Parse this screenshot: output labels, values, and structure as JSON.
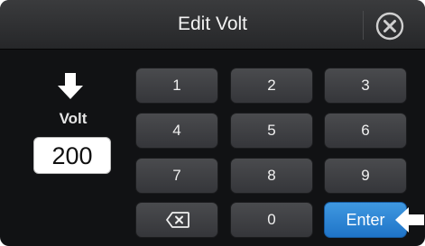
{
  "dialog": {
    "title": "Edit Volt",
    "close_icon": "close-circle-icon"
  },
  "field": {
    "label": "Volt",
    "value": "200",
    "indicator_icon": "arrow-down-icon"
  },
  "keypad": {
    "keys": [
      "1",
      "2",
      "3",
      "4",
      "5",
      "6",
      "7",
      "8",
      "9"
    ],
    "backspace_icon": "backspace-icon",
    "zero": "0",
    "enter": "Enter",
    "enter_indicator_icon": "arrow-left-icon"
  },
  "colors": {
    "background": "#111214",
    "key": "#3f4043",
    "enter": "#2a86d6",
    "text": "#f0f0f0"
  }
}
